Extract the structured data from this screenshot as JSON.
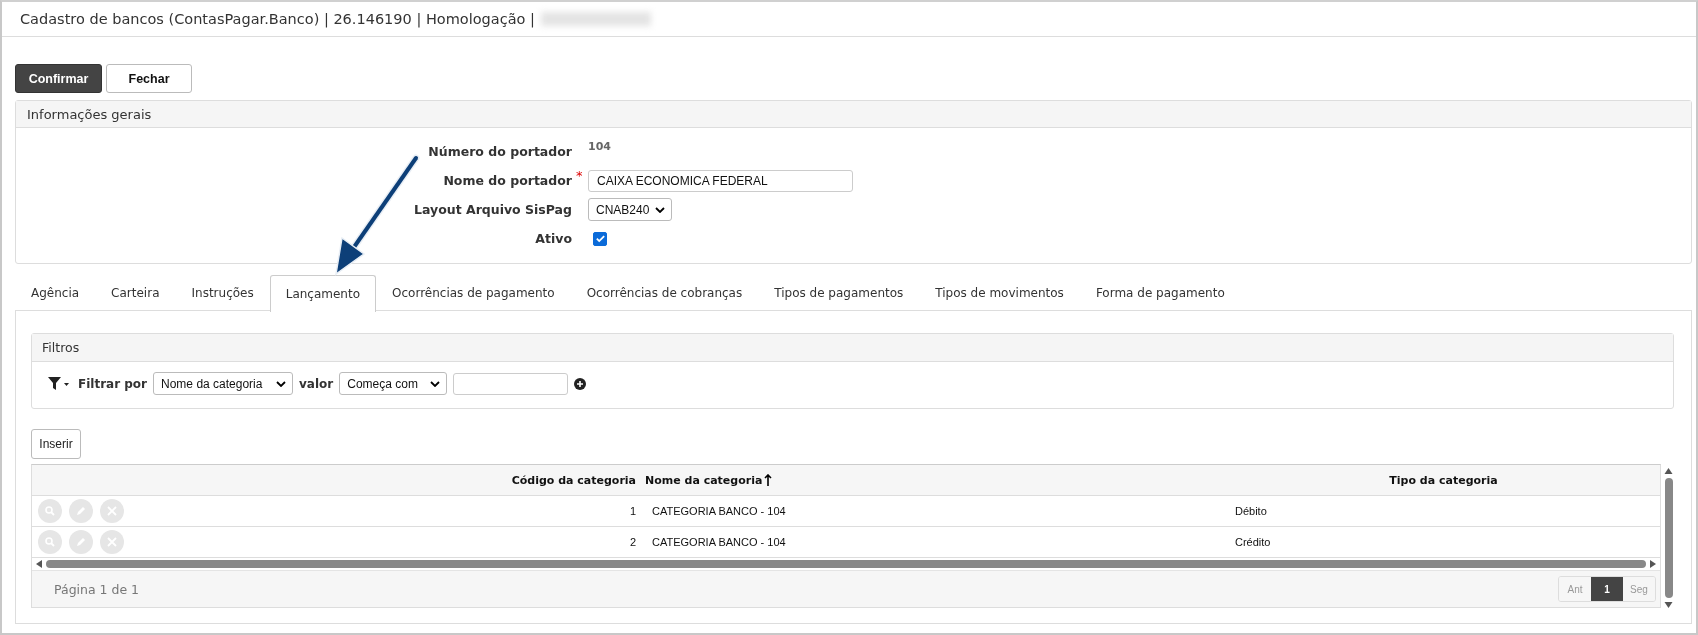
{
  "window": {
    "title": "Cadastro de bancos (ContasPagar.Banco) | 26.146190 | Homologação |"
  },
  "buttons": [
    {
      "label": "Confirmar",
      "kind": "primary"
    },
    {
      "label": "Fechar",
      "kind": "secondary"
    }
  ],
  "general_panel": {
    "title": "Informações gerais",
    "fields": [
      {
        "label": "Número do portador",
        "kind": "readonly",
        "value": "104"
      },
      {
        "label": "Nome do portador",
        "kind": "text",
        "required_mark": "*",
        "value": "CAIXA ECONOMICA FEDERAL"
      },
      {
        "label": "Layout Arquivo SisPag",
        "kind": "select",
        "value": "CNAB240"
      },
      {
        "label": "Ativo",
        "kind": "checkbox",
        "checked": true
      }
    ]
  },
  "tabs": [
    {
      "label": "Agência",
      "selected": false
    },
    {
      "label": "Carteira",
      "selected": false
    },
    {
      "label": "Instruções",
      "selected": false
    },
    {
      "label": "Lançamento",
      "selected": true
    },
    {
      "label": "Ocorrências de pagamento",
      "selected": false
    },
    {
      "label": "Ocorrências de cobranças",
      "selected": false
    },
    {
      "label": "Tipos de pagamentos",
      "selected": false
    },
    {
      "label": "Tipos de movimentos",
      "selected": false
    },
    {
      "label": "Forma de pagamento",
      "selected": false
    }
  ],
  "filters": {
    "title": "Filtros",
    "filter_label": "Filtrar por",
    "field_select": "Nome da categoria",
    "value_label": "valor",
    "operator_select": "Começa com"
  },
  "insert_button": "Inserir",
  "table": {
    "columns": [
      {
        "label": "Código da categoria",
        "sorted": false
      },
      {
        "label": "Nome da categoria",
        "sorted": true
      },
      {
        "label": "Tipo da categoria",
        "sorted": false
      }
    ],
    "rows": [
      {
        "cells": [
          "1",
          "CATEGORIA BANCO - 104",
          "Débito"
        ]
      },
      {
        "cells": [
          "2",
          "CATEGORIA BANCO - 104",
          "Crédito"
        ]
      }
    ]
  },
  "pagination": {
    "summary": "Página 1 de 1",
    "prev": {
      "label": "Ant",
      "disabled": true
    },
    "pages": [
      {
        "label": "1",
        "selected": true
      }
    ],
    "next": {
      "label": "Seg",
      "disabled": true
    }
  }
}
